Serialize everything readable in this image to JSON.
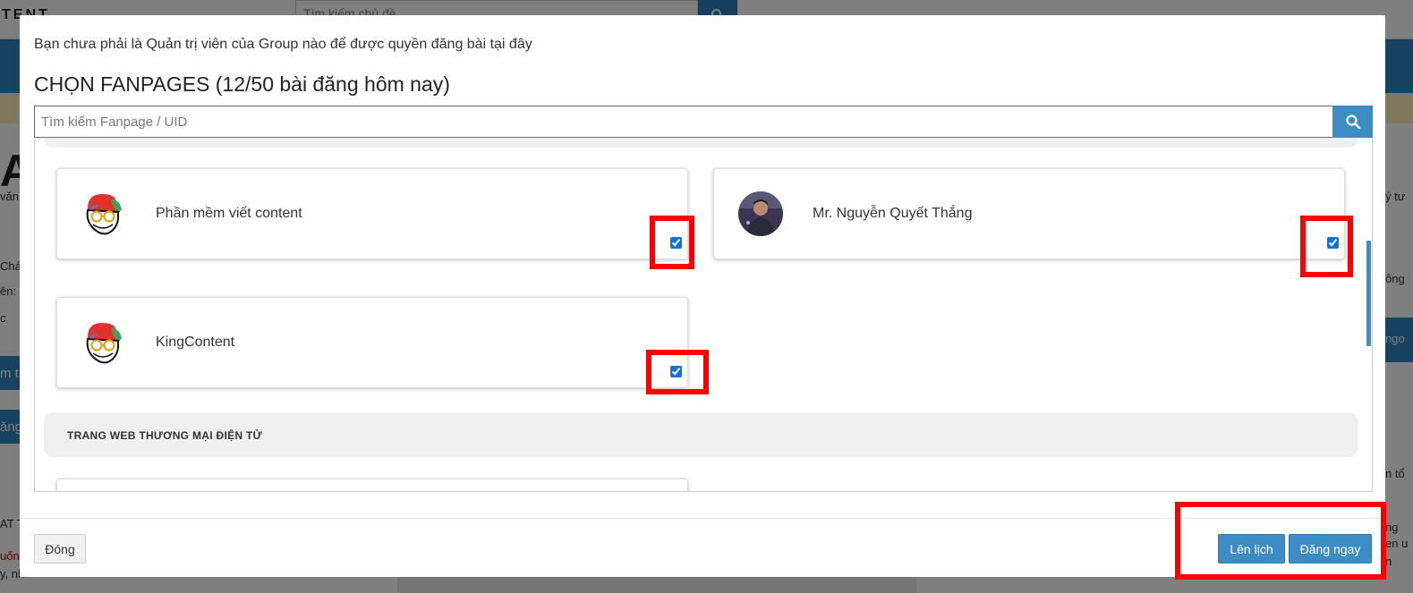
{
  "background": {
    "logo": "TENT",
    "search_placeholder": "Tìm kiếm chủ đề",
    "left_big": "A",
    "left_texts": [
      "văn",
      "Chá",
      "ên: I",
      "c",
      "m tr",
      "ăng",
      "AT T",
      "uốn",
      "y, nh"
    ],
    "right_texts": [
      "ý tư",
      "ông",
      "ngo",
      "n tổ",
      "ng",
      "en u",
      "n"
    ]
  },
  "modal": {
    "notice": "Bạn chưa phải là Quản trị viên của Group nào để được quyền đăng bài tại đây",
    "title": "CHỌN FANPAGES (12/50 bài đăng hôm nay)",
    "search": {
      "placeholder": "Tìm kiếm Fanpage / UID"
    },
    "fanpages": [
      {
        "name": "Phần mềm viết content",
        "checked": true,
        "icon": "cartoon-face-icon"
      },
      {
        "name": "Mr. Nguyễn Quyết Thắng",
        "checked": true,
        "icon": "profile-photo-avatar"
      },
      {
        "name": "KingContent",
        "checked": true,
        "icon": "cartoon-face-icon"
      }
    ],
    "group_heading": "TRANG WEB THƯƠNG MẠI ĐIỆN TỬ",
    "footer": {
      "close_label": "Đóng",
      "schedule_label": "Lên lịch",
      "post_now_label": "Đăng ngay"
    }
  },
  "colors": {
    "primary": "#3c8dc5",
    "highlight": "#ff0000",
    "overlay": "#000000"
  }
}
